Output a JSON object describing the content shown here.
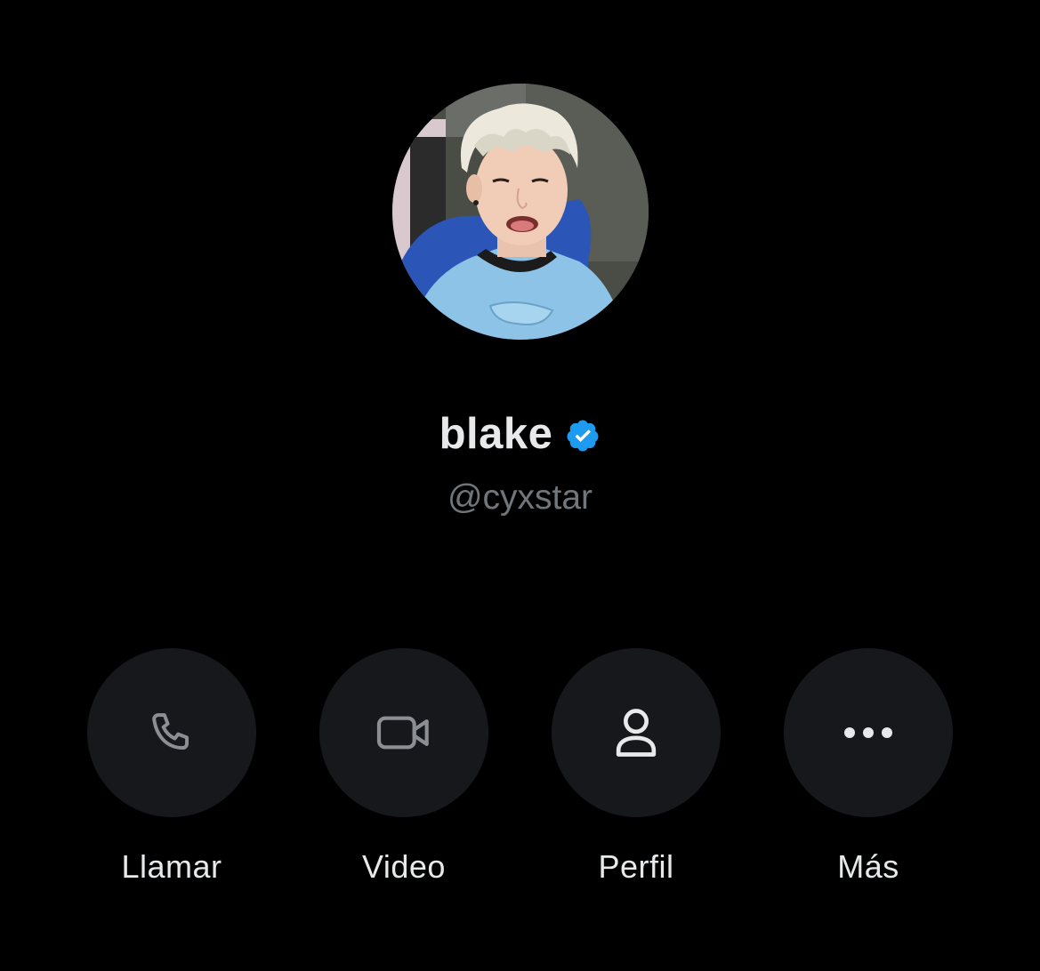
{
  "profile": {
    "display_name": "blake",
    "handle": "@cyxstar",
    "verified": true
  },
  "actions": [
    {
      "label": "Llamar",
      "icon": "phone-icon"
    },
    {
      "label": "Video",
      "icon": "video-camera-icon"
    },
    {
      "label": "Perfil",
      "icon": "person-icon"
    },
    {
      "label": "Más",
      "icon": "more-dots-icon"
    }
  ],
  "colors": {
    "background": "#000000",
    "button_background": "#16181c",
    "primary_text": "#e7e9ea",
    "secondary_text": "#71767b",
    "verified_badge": "#1d9bf0",
    "disabled_icon": "#8b8e92"
  }
}
